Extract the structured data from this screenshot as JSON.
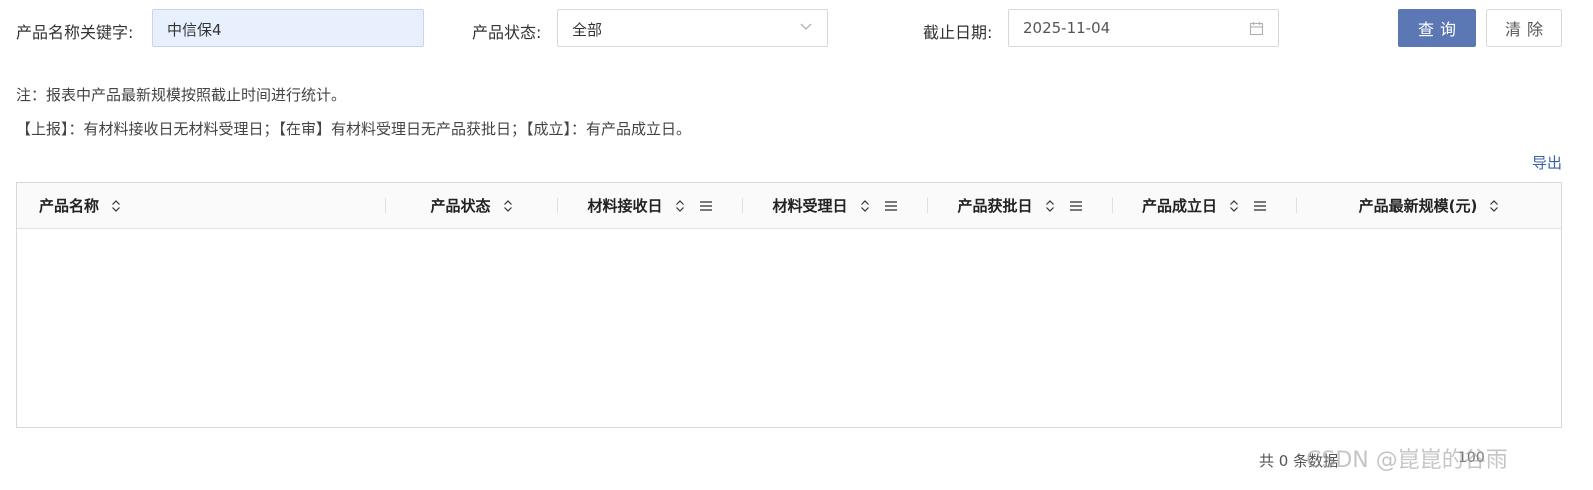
{
  "filters": {
    "keyword_label": "产品名称关键字:",
    "keyword_value": "中信保4",
    "status_label": "产品状态:",
    "status_value": "全部",
    "date_label": "截止日期:",
    "date_value": "2025-11-04"
  },
  "buttons": {
    "query": "查询",
    "clear": "清除"
  },
  "notes": {
    "line1": "注：报表中产品最新规模按照截止时间进行统计。",
    "line2": "【上报】：有材料接收日无材料受理日；【在审】有材料受理日无产品获批日；【成立】：有产品成立日。"
  },
  "export": "导出",
  "table": {
    "columns": [
      "产品名称",
      "产品状态",
      "材料接收日",
      "材料受理日",
      "产品获批日",
      "产品成立日",
      "产品最新规模(元)"
    ]
  },
  "pager": {
    "total": "共 0 条数据",
    "page_size": "100"
  },
  "watermark": "CSDN @崑崑的谷雨",
  "colors": {
    "primary": "#5b78b5",
    "link": "#3d5fa8",
    "keyword_bg": "#e8f0fe"
  }
}
